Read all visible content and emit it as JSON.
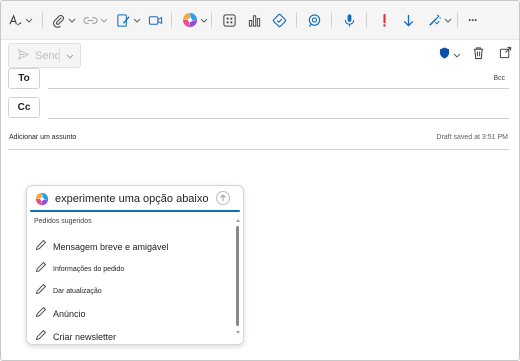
{
  "toolbar": {
    "icons": [
      "format-painter-icon",
      "attach-icon",
      "link-icon",
      "signature-icon",
      "video-icon",
      "copilot-icon",
      "apps-icon",
      "insights-icon",
      "editor-icon",
      "loop-icon",
      "dictate-icon",
      "importance-icon",
      "low-importance-icon",
      "sensitivity-icon",
      "more-options-icon"
    ],
    "more_label": "···"
  },
  "compose": {
    "send_label": "Send",
    "to_label": "To",
    "cc_label": "Cc",
    "bcc_label": "Bcc",
    "subject_placeholder": "Adicionar um assunto",
    "draft_status": "Draft saved at 3:51 PM"
  },
  "copilot": {
    "prompt_text": "experimente uma opção abaixo",
    "section_title": "Pedidos sugeridos",
    "suggestions": [
      "Mensagem breve e amigável",
      "Informações do pedido",
      "Dar atualização",
      "Anúncio",
      "Criar newsletter"
    ]
  },
  "colors": {
    "accent": "#0f6cbd",
    "importance": "#d13438",
    "toolbar_bg": "#f5f5f5"
  }
}
